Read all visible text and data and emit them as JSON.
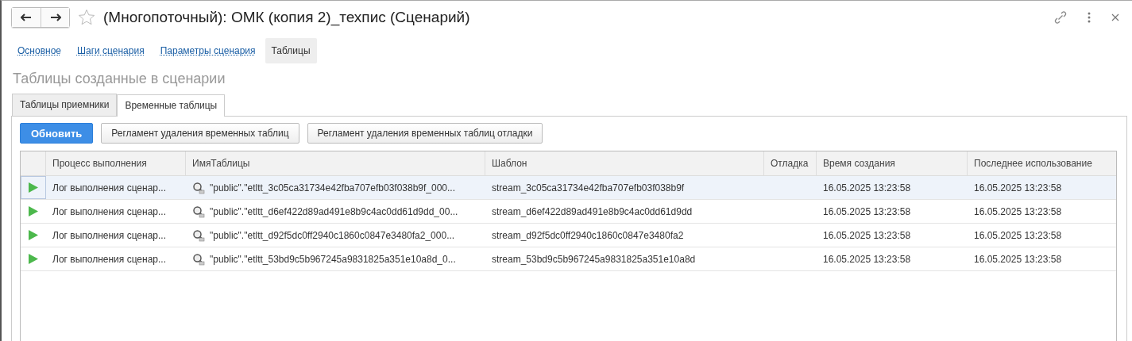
{
  "window": {
    "title": "(Многопоточный): ОМК (копия 2)_техпис (Сценарий)",
    "favorite": false
  },
  "sections": [
    {
      "label": "Основное",
      "selected": false
    },
    {
      "label": "Шаги сценария",
      "selected": false
    },
    {
      "label": "Параметры сценария",
      "selected": false
    },
    {
      "label": "Таблицы",
      "selected": true
    }
  ],
  "heading": "Таблицы созданные в сценарии",
  "tabs": [
    {
      "label": "Таблицы приемники",
      "selected": false
    },
    {
      "label": "Временные таблицы",
      "selected": true
    }
  ],
  "buttons": [
    {
      "label": "Обновить",
      "kind": "primary"
    },
    {
      "label": "Регламент удаления временных таблиц",
      "kind": "default"
    },
    {
      "label": "Регламент удаления временных таблиц отладки",
      "kind": "default"
    }
  ],
  "table": {
    "columns": [
      "Процесс выполнения",
      "ИмяТаблицы",
      "Шаблон",
      "Отладка",
      "Время создания",
      "Последнее использование"
    ],
    "rows": [
      {
        "selected": true,
        "process": "Лог выполнения сценар...",
        "name": "\"public\".\"etltt_3c05ca31734e42fba707efb03f038b9f_000...",
        "template": "stream_3c05ca31734e42fba707efb03f038b9f",
        "created": "16.05.2025 13:23:58",
        "last_used": "16.05.2025 13:23:58"
      },
      {
        "selected": false,
        "process": "Лог выполнения сценар...",
        "name": "\"public\".\"etltt_d6ef422d89ad491e8b9c4ac0dd61d9dd_00...",
        "template": "stream_d6ef422d89ad491e8b9c4ac0dd61d9dd",
        "created": "16.05.2025 13:23:58",
        "last_used": "16.05.2025 13:23:58"
      },
      {
        "selected": false,
        "process": "Лог выполнения сценар...",
        "name": "\"public\".\"etltt_d92f5dc0ff2940c1860c0847e3480fa2_000...",
        "template": "stream_d92f5dc0ff2940c1860c0847e3480fa2",
        "created": "16.05.2025 13:23:58",
        "last_used": "16.05.2025 13:23:58"
      },
      {
        "selected": false,
        "process": "Лог выполнения сценар...",
        "name": "\"public\".\"etltt_53bd9c5b967245a9831825a351e10a8d_0...",
        "template": "stream_53bd9c5b967245a9831825a351e10a8d",
        "created": "16.05.2025 13:23:58",
        "last_used": "16.05.2025 13:23:58"
      }
    ]
  }
}
